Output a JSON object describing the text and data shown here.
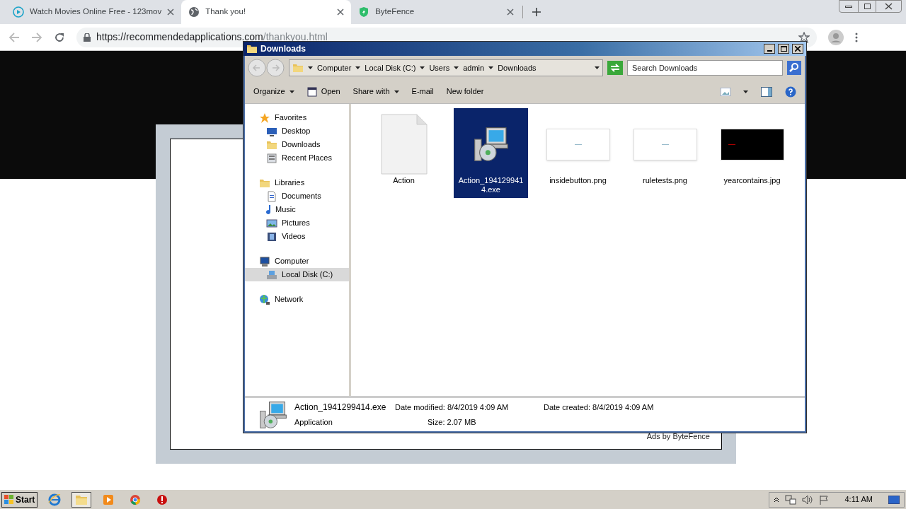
{
  "browser": {
    "tabs": [
      {
        "title": "Watch Movies Online Free - 123mov",
        "kind": "play",
        "selected": false
      },
      {
        "title": "Thank you!",
        "kind": "globe",
        "selected": true
      },
      {
        "title": "ByteFence",
        "kind": "shield",
        "selected": false
      }
    ],
    "url": {
      "host": "https://recommendedapplications.com",
      "path": "/thankyou.html"
    }
  },
  "page": {
    "footer_text": "Ads by ByteFence"
  },
  "explorer": {
    "title": "Downloads",
    "breadcrumb": [
      "Computer",
      "Local Disk (C:)",
      "Users",
      "admin",
      "Downloads"
    ],
    "search": {
      "placeholder": "Search Downloads"
    },
    "toolbar": [
      {
        "label": "Organize",
        "kind": "menu"
      },
      {
        "label": "Open",
        "kind": "icon"
      },
      {
        "label": "Share with",
        "kind": "menu"
      },
      {
        "label": "E-mail",
        "kind": "plain"
      },
      {
        "label": "New folder",
        "kind": "plain"
      }
    ],
    "nav": [
      {
        "label": "Favorites",
        "kind": "star",
        "selected": false,
        "children": [
          {
            "label": "Desktop",
            "kind": "desktop",
            "selected": false
          },
          {
            "label": "Downloads",
            "kind": "folder",
            "selected": false
          },
          {
            "label": "Recent Places",
            "kind": "recent",
            "selected": false
          }
        ]
      },
      {
        "label": "Libraries",
        "kind": "folder",
        "selected": false,
        "children": [
          {
            "label": "Documents",
            "kind": "doc",
            "selected": false
          },
          {
            "label": "Music",
            "kind": "music",
            "selected": false
          },
          {
            "label": "Pictures",
            "kind": "picture",
            "selected": false
          },
          {
            "label": "Videos",
            "kind": "video",
            "selected": false
          }
        ]
      },
      {
        "label": "Computer",
        "kind": "computer",
        "selected": false,
        "children": [
          {
            "label": "Local Disk (C:)",
            "kind": "disk",
            "selected": true
          }
        ]
      },
      {
        "label": "Network",
        "kind": "network",
        "selected": false
      }
    ],
    "files": [
      {
        "name": "Action",
        "kind": "blank",
        "selected": false
      },
      {
        "name": "Action_1941299414.exe",
        "kind": "installer",
        "selected": true
      },
      {
        "name": "insidebutton.png",
        "kind": "white-image",
        "selected": false
      },
      {
        "name": "ruletests.png",
        "kind": "white-image",
        "selected": false
      },
      {
        "name": "yearcontains.jpg",
        "kind": "black-image",
        "selected": false
      }
    ],
    "details": {
      "name": "Action_1941299414.exe",
      "type": "Application",
      "fields": [
        {
          "label": "Date modified:",
          "value": "8/4/2019 4:09 AM"
        },
        {
          "label": "Date created:",
          "value": "8/4/2019 4:09 AM"
        },
        {
          "label": "Size:",
          "value": "2.07 MB"
        }
      ]
    }
  },
  "taskbar": {
    "start": "Start",
    "apps": [
      {
        "kind": "ie",
        "selected": false
      },
      {
        "kind": "explorer",
        "selected": true
      },
      {
        "kind": "media",
        "selected": false
      },
      {
        "kind": "chrome",
        "selected": false
      },
      {
        "kind": "stop",
        "selected": false
      }
    ],
    "clock": "4:11 AM"
  }
}
